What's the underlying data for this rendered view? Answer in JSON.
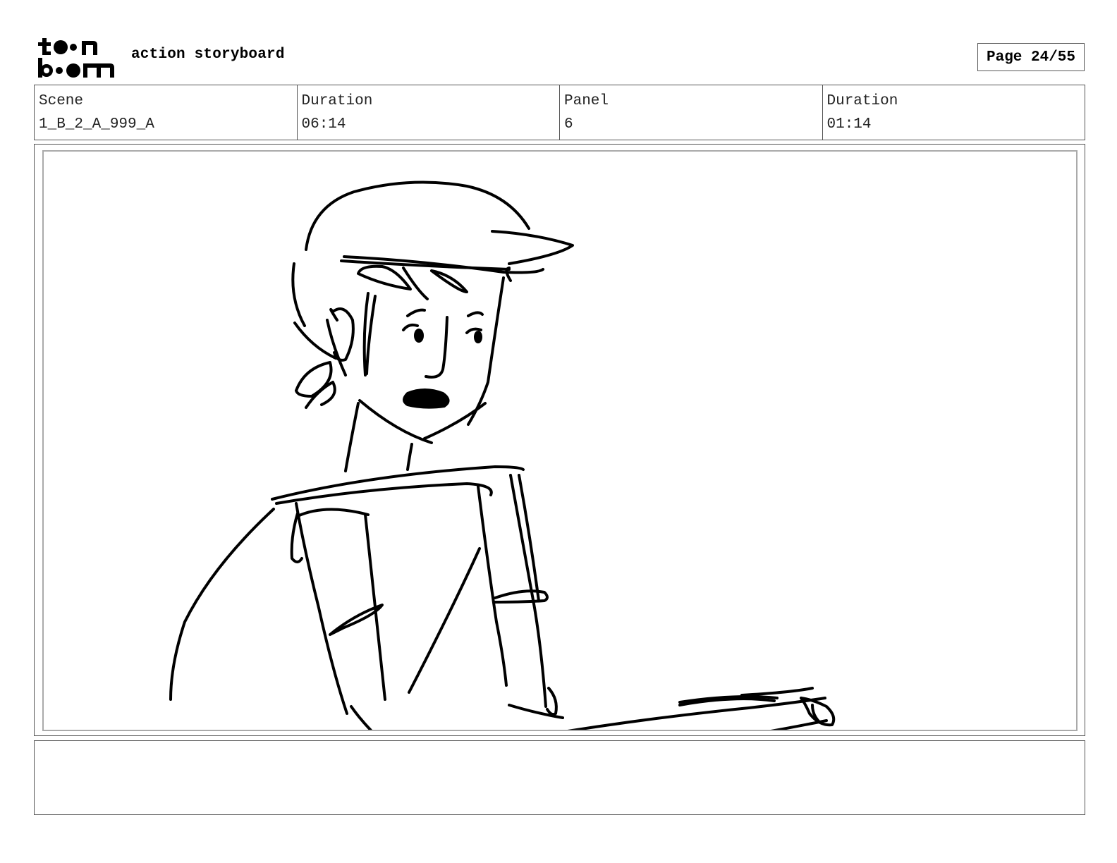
{
  "header": {
    "logo_text": "toon boom",
    "title": "action storyboard",
    "page_label": "Page 24/55"
  },
  "info": {
    "scene_label": "Scene",
    "scene_value": "1_B_2_A_999_A",
    "scene_duration_label": "Duration",
    "scene_duration_value": "06:14",
    "panel_label": "Panel",
    "panel_value": "6",
    "panel_duration_label": "Duration",
    "panel_duration_value": "01:14"
  },
  "panel": {
    "image_description_icon": "sketch-character-helmet"
  },
  "notes": {
    "text": ""
  }
}
